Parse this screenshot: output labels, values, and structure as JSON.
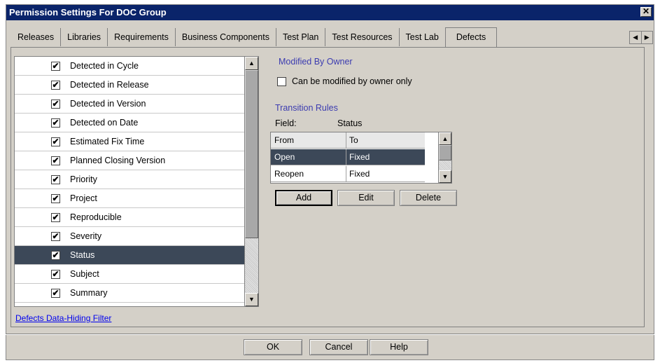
{
  "window": {
    "title": "Permission Settings For DOC Group",
    "close_glyph": "✕"
  },
  "tabs": [
    {
      "label": "Releases"
    },
    {
      "label": "Libraries"
    },
    {
      "label": "Requirements"
    },
    {
      "label": "Business Components"
    },
    {
      "label": "Test Plan"
    },
    {
      "label": "Test Resources"
    },
    {
      "label": "Test Lab"
    },
    {
      "label": "Defects",
      "active": true
    }
  ],
  "tab_scroll": {
    "left": "◀",
    "right": "▶"
  },
  "fields_list": {
    "items": [
      {
        "label": "Detected in Cycle",
        "checked": true
      },
      {
        "label": "Detected in Release",
        "checked": true
      },
      {
        "label": "Detected in Version",
        "checked": true
      },
      {
        "label": "Detected on Date",
        "checked": true
      },
      {
        "label": "Estimated Fix Time",
        "checked": true
      },
      {
        "label": "Planned Closing Version",
        "checked": true
      },
      {
        "label": "Priority",
        "checked": true
      },
      {
        "label": "Project",
        "checked": true
      },
      {
        "label": "Reproducible",
        "checked": true
      },
      {
        "label": "Severity",
        "checked": true
      },
      {
        "label": "Status",
        "checked": true,
        "selected": true
      },
      {
        "label": "Subject",
        "checked": true
      },
      {
        "label": "Summary",
        "checked": true
      }
    ],
    "check_glyph": "✔",
    "scroll_up": "▲",
    "scroll_down": "▼"
  },
  "filter_link": "Defects Data-Hiding Filter",
  "modified_by_owner": {
    "title": "Modified By Owner",
    "checkbox_label": "Can be modified by owner only",
    "checked": false
  },
  "transition_rules": {
    "title": "Transition Rules",
    "field_label": "Field:",
    "field_value": "Status",
    "columns": [
      "From",
      "To"
    ],
    "rows": [
      {
        "from": "Open",
        "to": "Fixed",
        "selected": true
      },
      {
        "from": "Reopen",
        "to": "Fixed",
        "selected": false
      }
    ],
    "buttons": {
      "add": "Add",
      "edit": "Edit",
      "delete": "Delete"
    }
  },
  "dialog_buttons": {
    "ok": "OK",
    "cancel": "Cancel",
    "help": "Help"
  },
  "colors": {
    "title_bar": "#0a246a",
    "selection": "#3c4858",
    "section_title": "#3b3bb0",
    "link": "#0000ee"
  }
}
